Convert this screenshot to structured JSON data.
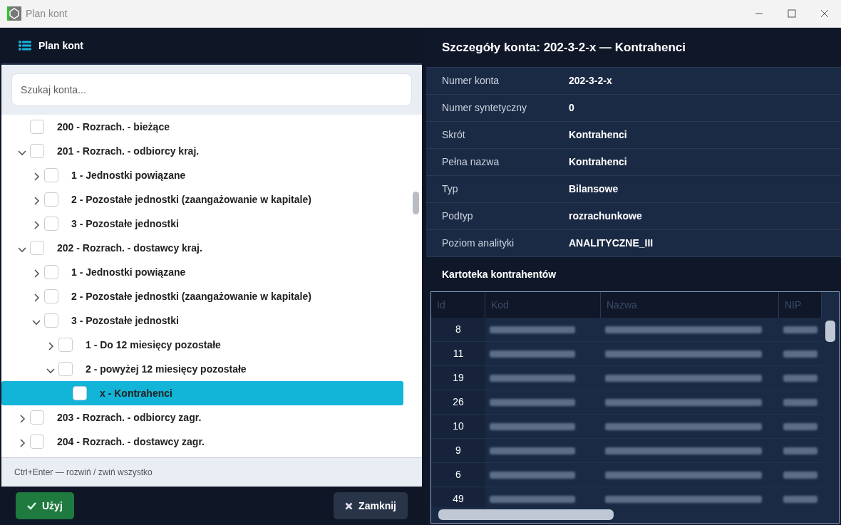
{
  "window": {
    "title": "Plan kont"
  },
  "left_panel": {
    "title": "Plan kont",
    "search": {
      "placeholder": "Szukaj konta..."
    },
    "tree": [
      {
        "label": "200 - Rozrach. - bieżące",
        "checked": false,
        "selected": false
      },
      {
        "label": "201 - Rozrach. - odbiorcy kraj.",
        "checked": false,
        "selected": false,
        "expanded": true,
        "children": [
          {
            "label": "1 - Jednostki powiązane",
            "checked": false,
            "selected": false,
            "expanded": false
          },
          {
            "label": "2 - Pozostałe jednostki (zaangażowanie w kapitale)",
            "checked": false,
            "selected": false,
            "expanded": false
          },
          {
            "label": "3 - Pozostałe jednostki",
            "checked": false,
            "selected": false,
            "expanded": false
          }
        ]
      },
      {
        "label": "202 - Rozrach. - dostawcy kraj.",
        "checked": false,
        "selected": false,
        "expanded": true,
        "children": [
          {
            "label": "1 - Jednostki powiązane",
            "checked": false,
            "selected": false,
            "expanded": false
          },
          {
            "label": "2 - Pozostałe jednostki (zaangażowanie w kapitale)",
            "checked": false,
            "selected": false,
            "expanded": false
          },
          {
            "label": "3 - Pozostałe jednostki",
            "checked": false,
            "selected": false,
            "expanded": true,
            "children": [
              {
                "label": "1 - Do 12 miesięcy pozostałe",
                "checked": false,
                "selected": false,
                "expanded": false
              },
              {
                "label": "2 - powyżej 12 miesięcy pozostałe",
                "checked": false,
                "selected": false,
                "expanded": true,
                "children": [
                  {
                    "label": "x - Kontrahenci",
                    "checked": false,
                    "selected": true
                  }
                ]
              }
            ]
          }
        ]
      },
      {
        "label": "203 - Rozrach. - odbiorcy zagr.",
        "checked": false,
        "selected": false,
        "expanded": false
      },
      {
        "label": "204 - Rozrach. - dostawcy zagr.",
        "checked": false,
        "selected": false,
        "expanded": false
      }
    ],
    "hint": "Ctrl+Enter — rozwiń / zwiń wszystko",
    "buttons": [
      {
        "label": "Użyj",
        "kind": "primary"
      },
      {
        "label": "Zamknij",
        "kind": "close"
      }
    ]
  },
  "details": {
    "title": "Szczegóły konta: 202-3-2-x — Kontrahenci",
    "fields": [
      {
        "label": "Numer konta",
        "value": "202-3-2-x"
      },
      {
        "label": "Numer syntetyczny",
        "value": "0"
      },
      {
        "label": "Skrót",
        "value": "Kontrahenci"
      },
      {
        "label": "Pełna nazwa",
        "value": "Kontrahenci"
      },
      {
        "label": "Typ",
        "value": "Bilansowe"
      },
      {
        "label": "Podtyp",
        "value": "rozrachunkowe"
      },
      {
        "label": "Poziom analityki",
        "value": "ANALITYCZNE_III"
      }
    ],
    "table_title": "Kartoteka kontrahentów",
    "table": {
      "columns": [
        "Id",
        "Kod",
        "Nazwa",
        "NIP"
      ],
      "rows": [
        {
          "id": "8"
        },
        {
          "id": "11"
        },
        {
          "id": "19"
        },
        {
          "id": "26"
        },
        {
          "id": "10"
        },
        {
          "id": "9"
        },
        {
          "id": "6"
        },
        {
          "id": "49"
        }
      ]
    }
  }
}
